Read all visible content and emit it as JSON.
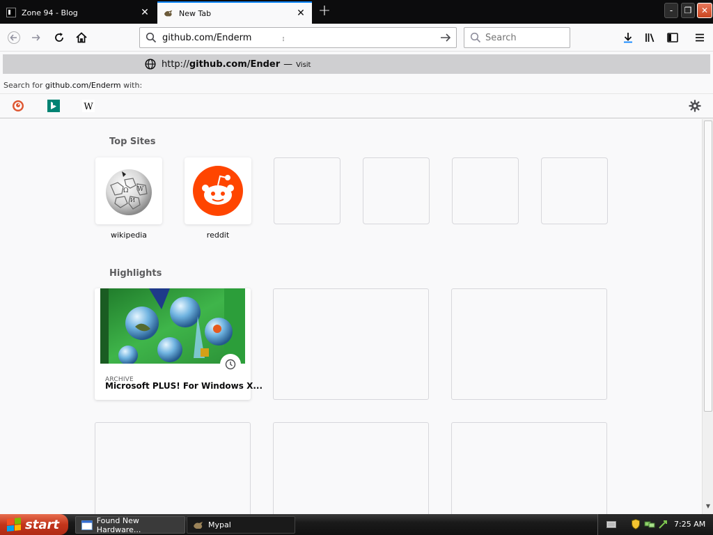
{
  "tabs": [
    {
      "title": "Zone 94 - Blog",
      "active": false
    },
    {
      "title": "New Tab",
      "active": true
    }
  ],
  "window_controls": {
    "minimize": "-",
    "maximize": "❐",
    "close": "✕"
  },
  "nav": {
    "url_value": "github.com/Enderm",
    "search_placeholder": "Search"
  },
  "autocomplete": {
    "url_prefix": "http://",
    "url_bold": "github.com/Ender",
    "separator": "—",
    "action": "Visit",
    "search_for_prefix": "Search for ",
    "search_for_query": "github.com/Enderm",
    "search_for_suffix": " with:",
    "engines": [
      "duckduckgo-icon",
      "bing-icon",
      "wikipedia-icon"
    ]
  },
  "top_sites": {
    "title": "Top Sites",
    "sites": [
      {
        "label": "wikipedia"
      },
      {
        "label": "reddit"
      },
      {
        "label": ""
      },
      {
        "label": ""
      },
      {
        "label": ""
      },
      {
        "label": ""
      }
    ]
  },
  "highlights": {
    "title": "Highlights",
    "cards": [
      {
        "context": "ARCHIVE",
        "title": "Microsoft PLUS! For Windows X..."
      }
    ]
  },
  "taskbar": {
    "start_label": "start",
    "tasks": [
      {
        "label": "Found New Hardware..."
      },
      {
        "label": "Mypal"
      }
    ],
    "clock": "7:25 AM"
  },
  "colors": {
    "accent": "#0a84ff",
    "reddit": "#ff4500",
    "start_button": "#c2351b"
  }
}
